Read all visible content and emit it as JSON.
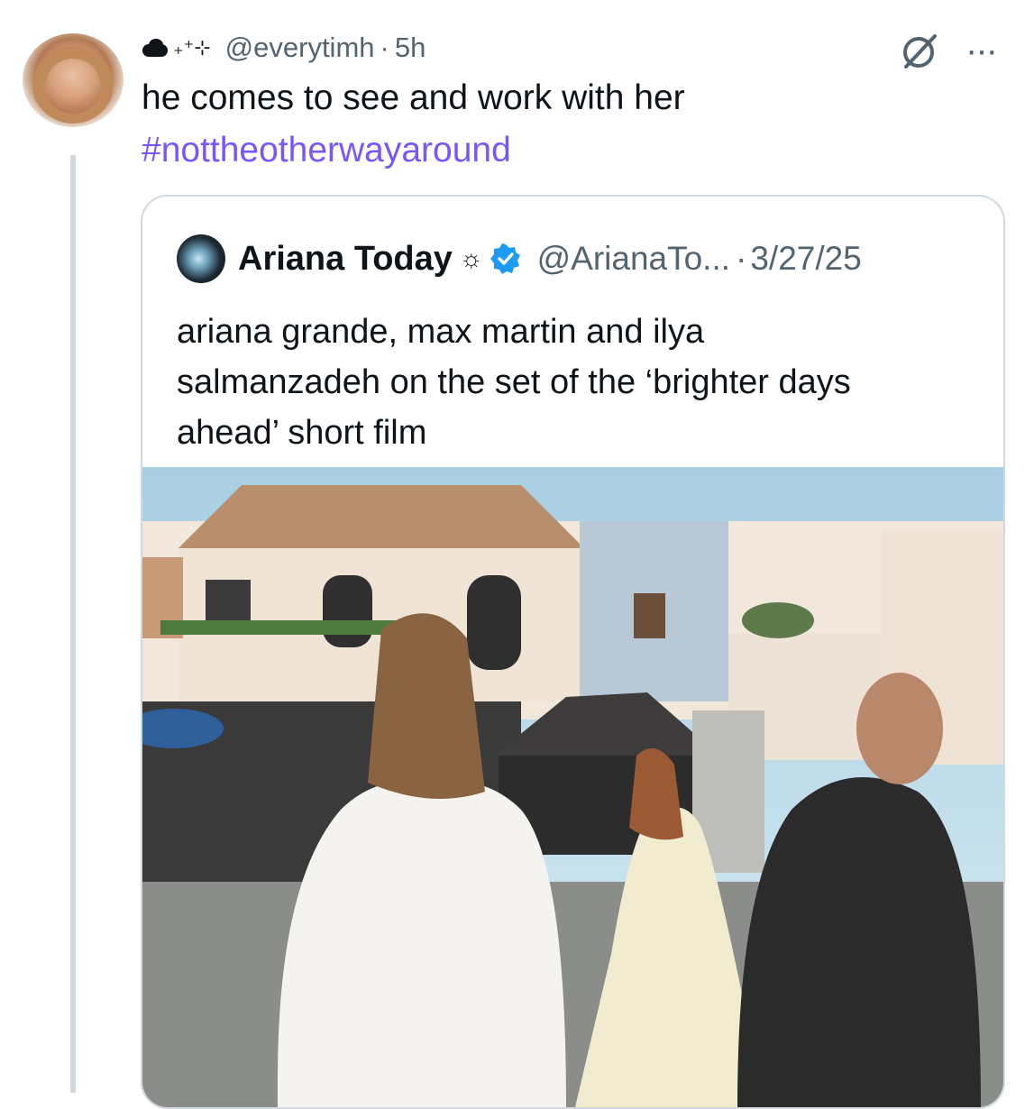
{
  "post": {
    "display_name": "",
    "handle": "@everytimh",
    "separator": "·",
    "time": "5h",
    "text": "he comes to see and work with her",
    "hashtag": "#nottheotherwayaround",
    "hashtag_color": "#7856ff",
    "icons": [
      "cloud-icon",
      "sparkle-icon",
      "grok-icon",
      "more-icon"
    ]
  },
  "quoted": {
    "name": "Ariana Today",
    "name_symbol": "☼",
    "verified_color": "#1d9bf0",
    "handle": "@ArianaTo...",
    "separator": "·",
    "date": "3/27/25",
    "text_lines": [
      "ariana grande, max martin and ilya",
      "salmanzadeh on the set of the ‘brighter days",
      "ahead’ short film"
    ]
  },
  "colors": {
    "text": "#0f1419",
    "secondary": "#536471",
    "border": "#cfd9de"
  }
}
